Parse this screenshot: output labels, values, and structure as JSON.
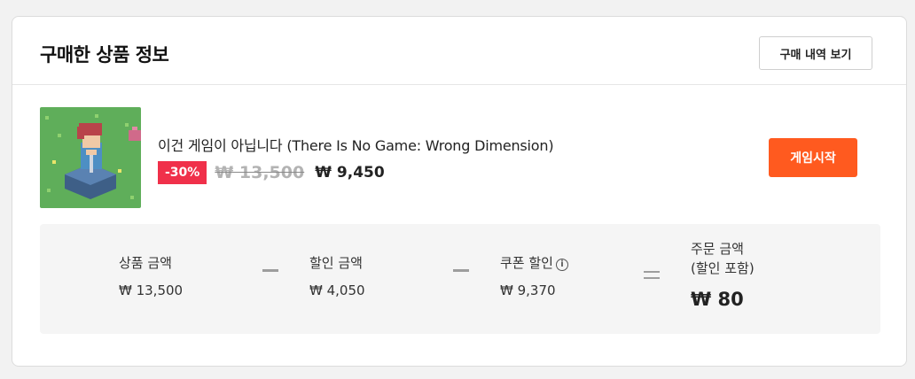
{
  "header": {
    "title": "구매한 상품 정보",
    "history_button": "구매 내역 보기"
  },
  "product": {
    "name": "이건 게임이 아닙니다 (There Is No Game: Wrong Dimension)",
    "discount": "-30%",
    "original_price": "₩ 13,500",
    "sale_price": "₩ 9,450",
    "play_button": "게임시작",
    "thumbnail_icon": "game-thumbnail-pixel-character"
  },
  "summary": {
    "product_amount": {
      "label": "상품 금액",
      "value": "₩ 13,500"
    },
    "discount_amount": {
      "label": "할인 금액",
      "value": "₩ 4,050"
    },
    "coupon_discount": {
      "label": "쿠폰 할인",
      "value": "₩ 9,370",
      "icon": "info-icon"
    },
    "order_amount": {
      "label_line1": "주문 금액",
      "label_line2": "(할인 포함)",
      "value": "₩ 80"
    }
  },
  "colors": {
    "accent": "#ff5a1f",
    "discount_badge": "#f0304a"
  }
}
